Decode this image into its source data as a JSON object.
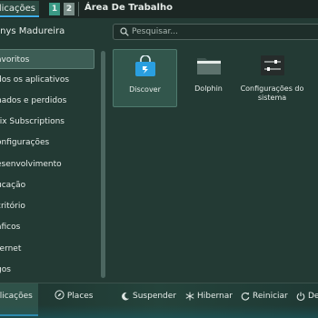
{
  "topbar": {
    "active_tab": "plicações",
    "desktops": [
      "1",
      "2"
    ],
    "area_title": "Área De Trabalho"
  },
  "user": {
    "name": "enys Madureira"
  },
  "search": {
    "placeholder": "Pesquisar..."
  },
  "categories": [
    "avoritos",
    "dos os aplicativos",
    "hados e perdidos",
    "rix Subscriptions",
    "onfigurações",
    "esenvolvimento",
    "ucação",
    "critório",
    "áficos",
    "ternet",
    "gos"
  ],
  "selected_category_index": 0,
  "apps": [
    {
      "label": "Discover",
      "icon": "shopping-bag-icon"
    },
    {
      "label": "Dolphin",
      "icon": "folder-icon"
    },
    {
      "label": "Configurações do sistema",
      "icon": "settings-sliders-icon"
    }
  ],
  "bottom": {
    "tab_apps": "plicações",
    "tab_places": "Places",
    "suspend": "Suspender",
    "hibernate": "Hibernar",
    "restart": "Reiniciar",
    "shutdown": "De"
  },
  "colors": {
    "accent": "#3daee9",
    "background": "#233a34",
    "selection": "#3d5d55"
  }
}
